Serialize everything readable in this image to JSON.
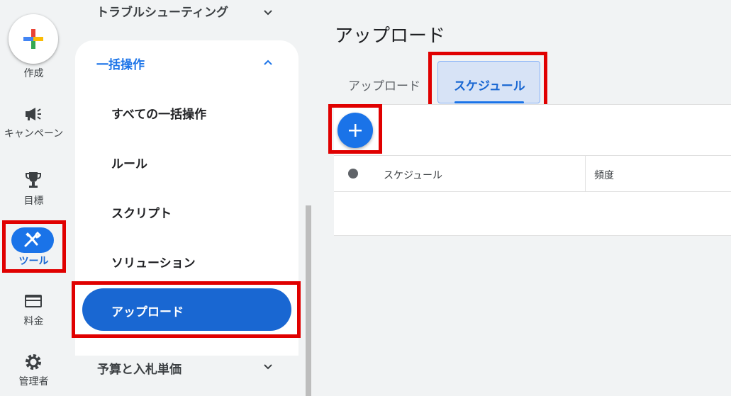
{
  "rail": {
    "create_label": "作成",
    "campaign_label": "キャンペーン",
    "goals_label": "目標",
    "tools_label": "ツール",
    "billing_label": "料金",
    "admin_label": "管理者"
  },
  "nav": {
    "troubleshooting": "トラブルシューティング",
    "bulk_section": "一括操作",
    "bulk_items": [
      "すべての一括操作",
      "ルール",
      "スクリプト",
      "ソリューション"
    ],
    "active_item": "アップロード",
    "budget": "予算と入札単価"
  },
  "main": {
    "title": "アップロード",
    "tabs": [
      "アップロード",
      "スケジュール"
    ],
    "table_headers": [
      "スケジュール",
      "頻度"
    ]
  },
  "colors": {
    "accent": "#1a73e8",
    "highlight": "#e00000"
  }
}
